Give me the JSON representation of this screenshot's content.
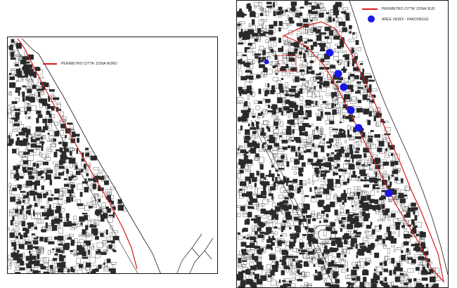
{
  "colors": {
    "perimeter": "#d7191c",
    "green_areas": "#1a16e6",
    "map_lines": "#1c1c1c",
    "panel_border": "#1a1a1a",
    "sea": "#ffffff"
  },
  "maps": {
    "nord": {
      "legend": {
        "perimeter_label": "PERIMETRO CITTA' ZONA NORD"
      }
    },
    "sud": {
      "legend": {
        "perimeter_label": "PERIMETRO CITTA' ZONA SUD",
        "green_areas_label": "AREE VERDI - PARCHEGGI"
      },
      "marker_icon": "blue-circle-marker"
    }
  }
}
